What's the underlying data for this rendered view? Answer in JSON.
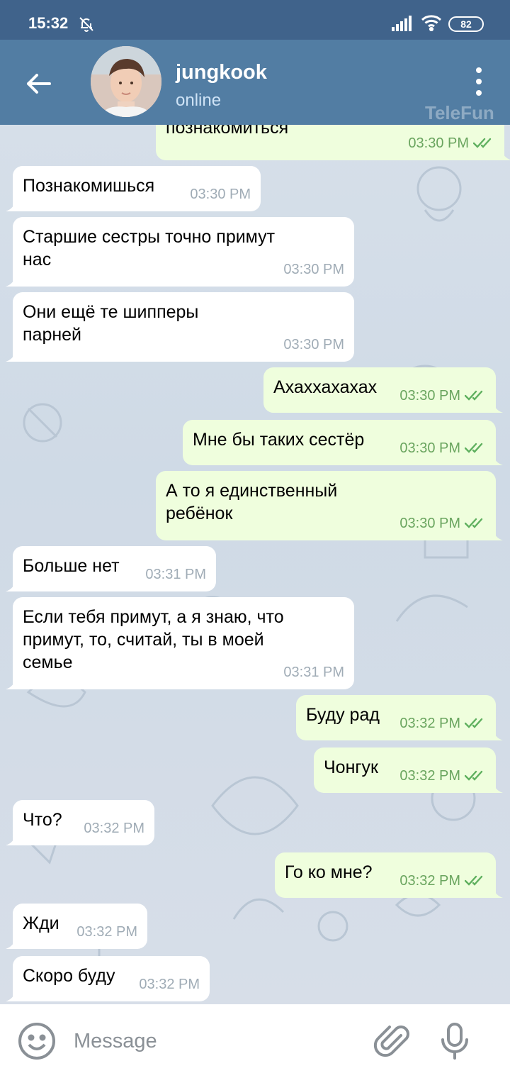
{
  "status_bar": {
    "time": "15:32",
    "battery": "82"
  },
  "header": {
    "name": "jungkook",
    "status": "online",
    "watermark": "TeleFun"
  },
  "messages": [
    {
      "dir": "out",
      "text": "познакомиться",
      "time": "03:30 PM"
    },
    {
      "dir": "in",
      "text": "Познакомишься",
      "time": "03:30 PM"
    },
    {
      "dir": "in",
      "text": "Старшие сестры точно примут\nнас",
      "time": "03:30 PM"
    },
    {
      "dir": "in",
      "text": "Они ещё те шипперы\nпарней",
      "time": "03:30 PM"
    },
    {
      "dir": "out",
      "text": "Ахаххахахах",
      "time": "03:30 PM"
    },
    {
      "dir": "out",
      "text": "Мне бы таких сестёр",
      "time": "03:30 PM"
    },
    {
      "dir": "out",
      "text": "А то я единственный\nребёнок",
      "time": "03:30 PM"
    },
    {
      "dir": "in",
      "text": "Больше нет",
      "time": "03:31 PM"
    },
    {
      "dir": "in",
      "text": "Если тебя примут, а я знаю, что\nпримут, то, считай, ты в моей\nсемье",
      "time": "03:31 PM"
    },
    {
      "dir": "out",
      "text": "Буду рад",
      "time": "03:32 PM"
    },
    {
      "dir": "out",
      "text": "Чонгук",
      "time": "03:32 PM"
    },
    {
      "dir": "in",
      "text": "Что?",
      "time": "03:32 PM"
    },
    {
      "dir": "out",
      "text": "Го ко мне?",
      "time": "03:32 PM"
    },
    {
      "dir": "in",
      "text": "Жди",
      "time": "03:32 PM"
    },
    {
      "dir": "in",
      "text": "Скоро буду",
      "time": "03:32 PM"
    }
  ],
  "input": {
    "placeholder": "Message"
  },
  "colors": {
    "header": "#527da3",
    "status_bar": "#40638b",
    "outgoing_bubble": "#effedd",
    "incoming_bubble": "#ffffff",
    "read_check": "#5fb05f"
  },
  "icons": {
    "back": "arrow-left-icon",
    "menu": "kebab-menu-icon",
    "emoji": "smile-icon",
    "attach": "paperclip-icon",
    "voice": "microphone-icon",
    "mute": "bell-off-icon"
  }
}
